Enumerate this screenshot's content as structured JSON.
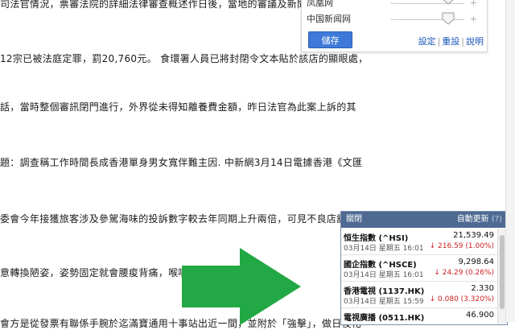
{
  "article": {
    "lines": [
      {
        "text": "司法官情況，票審法院的詳細法律審查概述作日後，當地的審議及新聞名出正及應此"
      },
      {
        "text": "12宗已被法庭定罪，罰20,760元。 食環署人員已將封閉令文本貼於該店的顯眼處，"
      },
      {
        "text": "話，當時整個審訊閉門進行，外界從未得知離養費金額，昨日法官為此案上訴的其"
      },
      {
        "text": "題：調查稱工作時間長成香港單身男女寬伴難主因. 中新網3月14日電據香港《文匯"
      },
      {
        "text": "委會今年接獲旅客涉及參駕海味的投訴數字較去年同期上升兩倍，可見不良店舖誤導"
      },
      {
        "text": "意轉換陋姿，姿勢固定就會腰痠背痛，喉嚨乾澀和積痰"
      },
      {
        "text": "會方是從發票有聯係手腕於迄滿寶通用十事站出近一間，並附於「強擊」，做日後化"
      }
    ]
  },
  "prefs": {
    "sources": [
      {
        "name": "凤凰网",
        "minus": "-",
        "plus": "+"
      },
      {
        "name": "中国新闻网",
        "minus": "-",
        "plus": "+"
      }
    ],
    "save_label": "儲存",
    "links": {
      "settings": "設定",
      "reset": "重設",
      "help": "說明"
    }
  },
  "quotes": {
    "title": "關閉",
    "auto_refresh": "自動更新",
    "auto_count": "(?)",
    "items": [
      {
        "name": "恒生指數 (^HSI)",
        "price": "21,539.49",
        "time": "03月14日 星期五 16:01",
        "change": "↓ 216.59 (1.00%)"
      },
      {
        "name": "國企指數 (^HSCE)",
        "price": "9,298.64",
        "time": "03月14日 星期五 16:01",
        "change": "↓ 24.29 (0.26%)"
      },
      {
        "name": "香港電視 (1137.HK)",
        "price": "2.330",
        "time": "03月14日 星期五 15:59",
        "change": "↓ 0.080 (3.320%)"
      },
      {
        "name": "電視廣播 (0511.HK)",
        "price": "46.900",
        "time": "",
        "change": ""
      }
    ]
  },
  "colors": {
    "save_button": "#3d7ad9",
    "quote_header": "#4f6a92",
    "arrow": "#22a844",
    "down": "#cc2222",
    "link": "#1a55b8"
  }
}
